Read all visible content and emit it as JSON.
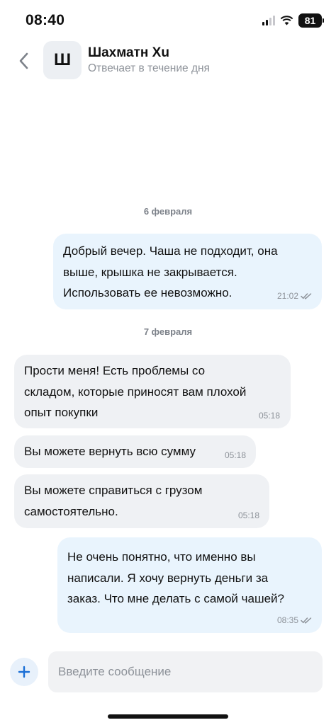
{
  "status_bar": {
    "time": "08:40",
    "battery": "81",
    "icons": [
      "cellular-signal-icon",
      "wifi-icon",
      "battery-icon"
    ]
  },
  "header": {
    "back_icon": "chevron-left-icon",
    "avatar_letter": "Ш",
    "contact_name": "Шахматн Хu",
    "contact_status": "Отвечает в течение дня"
  },
  "dates": [
    "6 февраля",
    "7 февраля"
  ],
  "messages": [
    {
      "direction": "outgoing",
      "lines": [
        "Добрый вечер. Чаша не подходит, она",
        "выше, крышка не закрывается.",
        "Использовать ее невозможно."
      ],
      "time": "21:02",
      "read": true
    },
    {
      "direction": "incoming",
      "lines": [
        "Прости меня!  Есть проблемы со",
        "складом, которые приносят вам плохой",
        "опыт покупки"
      ],
      "time": "05:18"
    },
    {
      "direction": "incoming",
      "lines": [
        "Вы можете вернуть всю сумму"
      ],
      "time": "05:18"
    },
    {
      "direction": "incoming",
      "lines": [
        "Вы можете справиться с грузом",
        "самостоятельно."
      ],
      "time": "05:18"
    },
    {
      "direction": "outgoing",
      "lines": [
        "Не очень понятно, что именно вы",
        "написали. Я хочу вернуть деньги за",
        "заказ. Что мне делать с самой чашей?"
      ],
      "time": "08:35",
      "read": true
    }
  ],
  "composer": {
    "add_icon": "plus-icon",
    "placeholder": "Введите сообщение",
    "value": ""
  },
  "colors": {
    "outgoing_bubble": "#e9f4fd",
    "incoming_bubble": "#eff1f4",
    "accent": "#1a6fd6",
    "secondary_text": "#8d9299"
  }
}
